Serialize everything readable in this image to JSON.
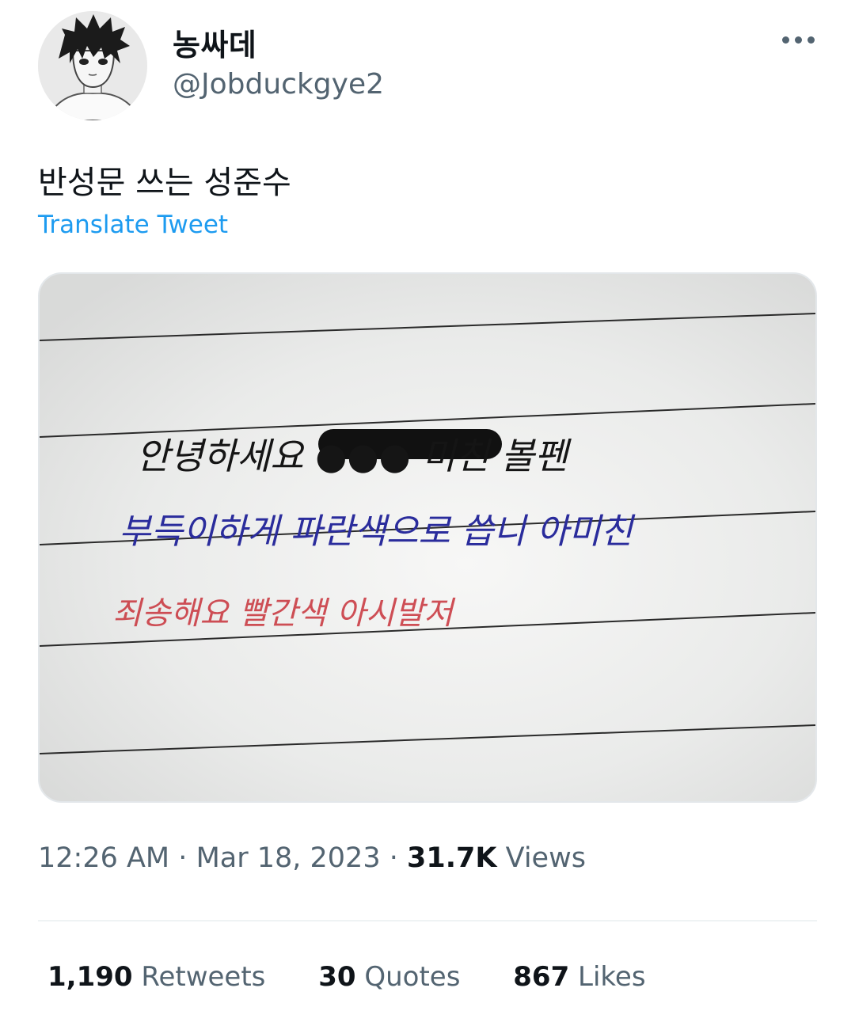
{
  "user": {
    "display_name": "농싸데",
    "handle": "@Jobduckgye2",
    "avatar_icon": "anime-character-avatar"
  },
  "actions": {
    "more_icon": "more-horizontal-icon"
  },
  "tweet": {
    "text": "반성문 쓰는 성준수",
    "translate_label": "Translate Tweet",
    "media": {
      "lines": [
        {
          "text": "안녕하세요 ●●● 미친 볼펜",
          "color": "#151515"
        },
        {
          "text": "부득이하게 파란색으로 씁니 아미친",
          "color": "#2a2c9c"
        },
        {
          "text": "죄송해요 빨간색 아시발저",
          "color": "#c8323a"
        }
      ]
    }
  },
  "meta": {
    "time": "12:26 AM",
    "separator": "·",
    "date": "Mar 18, 2023",
    "views_count": "31.7K",
    "views_label": "Views"
  },
  "stats": {
    "retweets_count": "1,190",
    "retweets_label": "Retweets",
    "quotes_count": "30",
    "quotes_label": "Quotes",
    "likes_count": "867",
    "likes_label": "Likes"
  },
  "colors": {
    "accent": "#1d9bf0",
    "secondary_text": "#536471",
    "primary_text": "#0f1419"
  }
}
